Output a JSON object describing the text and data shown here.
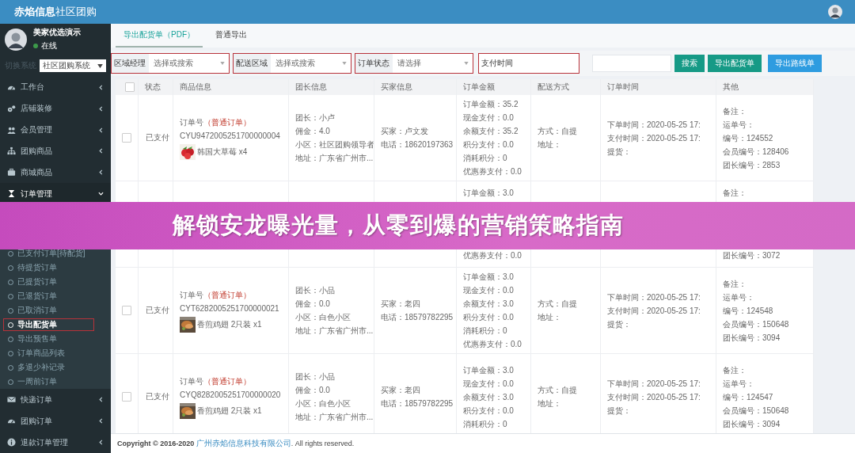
{
  "brand": {
    "bold": "赤焰信息",
    "light": "社区团购"
  },
  "user": {
    "name": "美家优选演示",
    "status": "在线",
    "online": true
  },
  "system_switch": {
    "label": "切换系统",
    "value": "社区团购系统"
  },
  "menu": [
    {
      "label": "工作台",
      "expanded": false
    },
    {
      "label": "店铺装修",
      "expanded": false
    },
    {
      "label": "会员管理",
      "expanded": false
    },
    {
      "label": "团购商品",
      "expanded": false
    },
    {
      "label": "商城商品",
      "expanded": false
    },
    {
      "label": "订单管理",
      "expanded": true,
      "children": [
        {
          "label": "已支付订单[待配货]",
          "selected": false,
          "outlined": false
        },
        {
          "label": "待提货订单",
          "selected": false,
          "outlined": false
        },
        {
          "label": "已提货订单",
          "selected": false,
          "outlined": false
        },
        {
          "label": "已退货订单",
          "selected": false,
          "outlined": false
        },
        {
          "label": "已取消订单",
          "selected": false,
          "outlined": false
        },
        {
          "label": "导出配货单",
          "selected": true,
          "outlined": true
        },
        {
          "label": "导出预售单",
          "selected": false,
          "outlined": false
        },
        {
          "label": "订单商品列表",
          "selected": false,
          "outlined": false
        },
        {
          "label": "多退少补记录",
          "selected": false,
          "outlined": false
        },
        {
          "label": "一周前订单",
          "selected": false,
          "outlined": false
        }
      ]
    },
    {
      "label": "快递订单",
      "expanded": false
    },
    {
      "label": "团购订单",
      "expanded": false
    },
    {
      "label": "退款订单管理",
      "expanded": false
    }
  ],
  "tabs": [
    {
      "label": "导出配货单（PDF）",
      "selected": true
    },
    {
      "label": "普通导出",
      "selected": false
    }
  ],
  "filters": [
    {
      "kind": "select",
      "label": "区域经理",
      "placeholder": "选择或搜索",
      "outlined": true
    },
    {
      "kind": "select",
      "label": "配送区域",
      "placeholder": "选择或搜索",
      "outlined": true
    },
    {
      "kind": "select",
      "label": "订单状态",
      "placeholder": "请选择",
      "outlined": true
    },
    {
      "kind": "date",
      "label": "支付时间",
      "outlined": true
    }
  ],
  "buttons": [
    {
      "label": "搜索",
      "kind": "primary"
    },
    {
      "label": "导出配货单",
      "kind": "primary"
    },
    {
      "label": "导出路线单",
      "kind": "info"
    }
  ],
  "table": {
    "select_all_checked": false,
    "columns": [
      "状态",
      "商品信息",
      "团长信息",
      "买家信息",
      "订单金额",
      "配送方式",
      "订单时间",
      "其他"
    ],
    "rows": [
      {
        "kind": "full",
        "checked": false,
        "status": "已支付",
        "order_label": "订单号",
        "order_type": "（普通订单）",
        "order_no": "CYU9472005251700000004",
        "product": "韩国大草莓 x4",
        "leader": [
          "团长：小卢",
          "佣金：4.0",
          "小区：社区团购领导者",
          "地址：广东省广州市..."
        ],
        "buyer": [
          "买家：卢文发",
          "电话：18620197363"
        ],
        "amount": [
          "订单金额：35.2",
          "现金支付：0.0",
          "余额支付：35.2",
          "积分支付：0.0",
          "消耗积分：0",
          "优惠券支付：0.0"
        ],
        "delivery": [
          "方式：自提",
          "地址："
        ],
        "time": [
          "下单时间：2020-05-25 17:",
          "支付时间：2020-05-25 17:",
          "提货："
        ],
        "other": [
          "备注：",
          "运单号：",
          "编号：124552",
          "会员编号：128406",
          "团长编号：2853"
        ]
      },
      {
        "kind": "partial",
        "amount": [
          "订单金额：3.0",
          "优惠券支付：0.0"
        ],
        "other": [
          "备注：",
          "团长编号：3072"
        ]
      },
      {
        "kind": "full",
        "checked": false,
        "status": "已支付",
        "order_label": "订单号",
        "order_type": "（普通订单）",
        "order_no": "CYT6282005251700000021",
        "product": "香煎鸡翅 2只装 x1",
        "leader": [
          "团长：小品",
          "佣金：0.0",
          "小区：白色小区",
          "地址：广东省广州市..."
        ],
        "buyer": [
          "买家：老四",
          "电话：18579782295"
        ],
        "amount": [
          "订单金额：3.0",
          "现金支付：0.0",
          "余额支付：3.0",
          "积分支付：0.0",
          "消耗积分：0",
          "优惠券支付：0.0"
        ],
        "delivery": [
          "方式：自提",
          "地址："
        ],
        "time": [
          "下单时间：2020-05-25 17:",
          "支付时间：2020-05-25 17:",
          "提货："
        ],
        "other": [
          "备注：",
          "运单号：",
          "编号：124548",
          "会员编号：150648",
          "团长编号：3094"
        ]
      },
      {
        "kind": "full",
        "checked": false,
        "status": "已支付",
        "order_label": "订单号",
        "order_type": "（普通订单）",
        "order_no": "CYQ8282005251700000020",
        "product": "香煎鸡翅 2只装 x1",
        "leader": [
          "团长：小品",
          "佣金：0.0",
          "小区：白色小区",
          "地址：广东省广州市..."
        ],
        "buyer": [
          "买家：老四",
          "电话：18579782295"
        ],
        "amount": [
          "订单金额：3.0",
          "现金支付：0.0",
          "余额支付：3.0",
          "积分支付：0.0",
          "消耗积分：0"
        ],
        "delivery": [
          "方式：自提",
          "地址："
        ],
        "time": [
          "下单时间：2020-05-25 17:",
          "支付时间：2020-05-25 17:",
          "提货："
        ],
        "other": [
          "备注：",
          "运单号：",
          "编号：124547",
          "会员编号：150648",
          "团长编号：3094"
        ]
      }
    ]
  },
  "footer": {
    "prefix": "Copyright © 2016-2020",
    "link": "广州赤焰信息科技有限公司",
    "suffix": ". All rights reserved."
  },
  "banner": {
    "title": "解锁安龙曝光量，从零到爆的营销策略指南"
  }
}
